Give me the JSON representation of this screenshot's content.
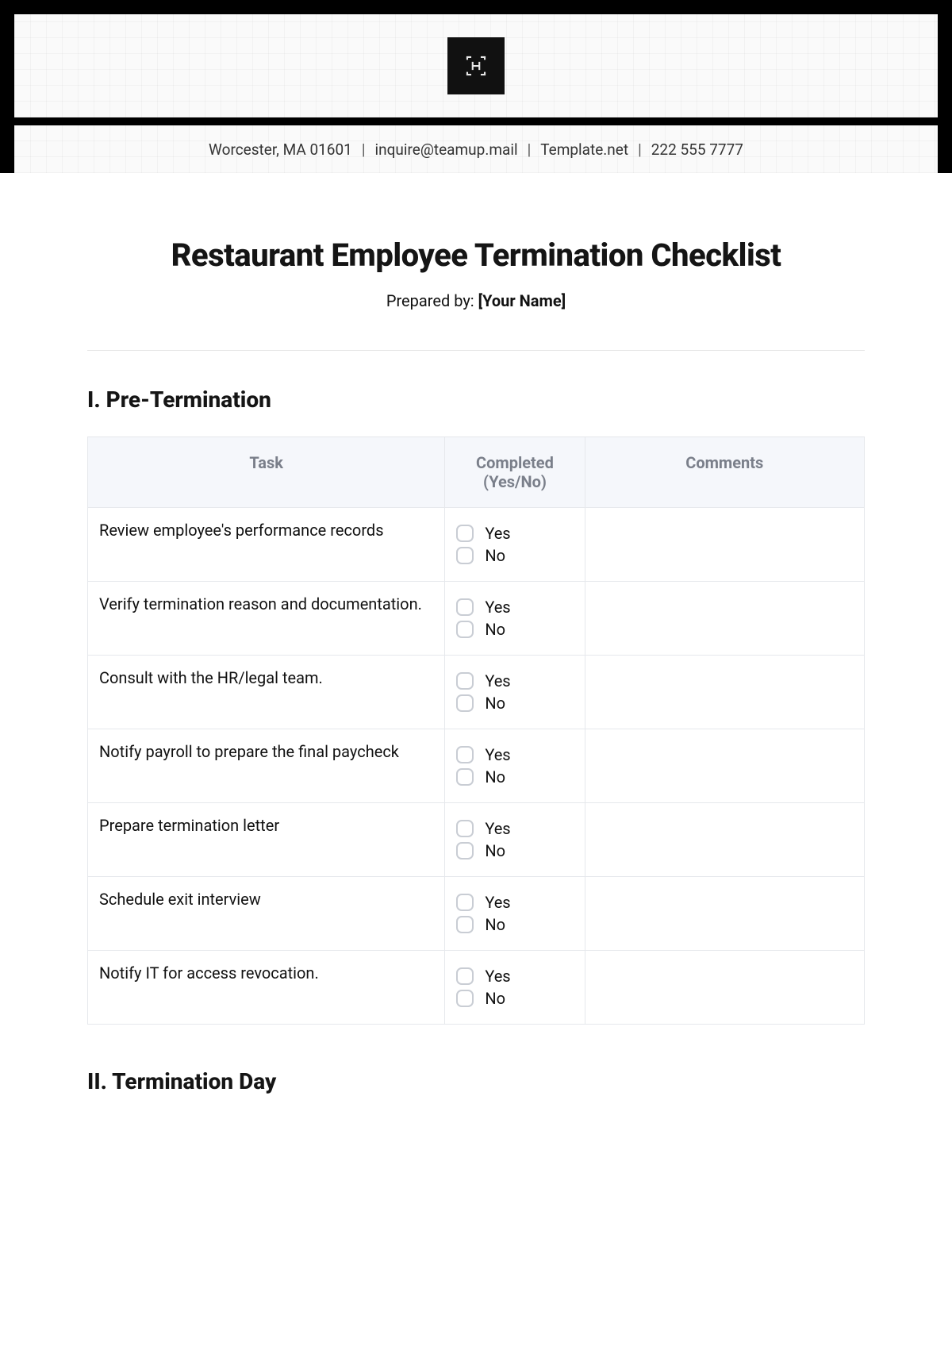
{
  "header": {
    "address": "Worcester, MA 01601",
    "email": "inquire@teamup.mail",
    "site": "Template.net",
    "phone": "222 555 7777",
    "separator": "|"
  },
  "document": {
    "title": "Restaurant Employee Termination Checklist",
    "prepared_label": "Prepared by: ",
    "prepared_value": "[Your Name]"
  },
  "columns": {
    "task": "Task",
    "completed": "Completed (Yes/No)",
    "comments": "Comments"
  },
  "labels": {
    "yes": "Yes",
    "no": "No"
  },
  "sections": [
    {
      "heading": "I. Pre-Termination",
      "tasks": [
        "Review employee's performance records",
        "Verify termination reason and documentation.",
        "Consult with the HR/legal team.",
        "Notify payroll to prepare the final paycheck",
        "Prepare termination letter",
        "Schedule exit interview",
        "Notify IT for access revocation."
      ]
    },
    {
      "heading": "II. Termination Day",
      "tasks": []
    }
  ]
}
